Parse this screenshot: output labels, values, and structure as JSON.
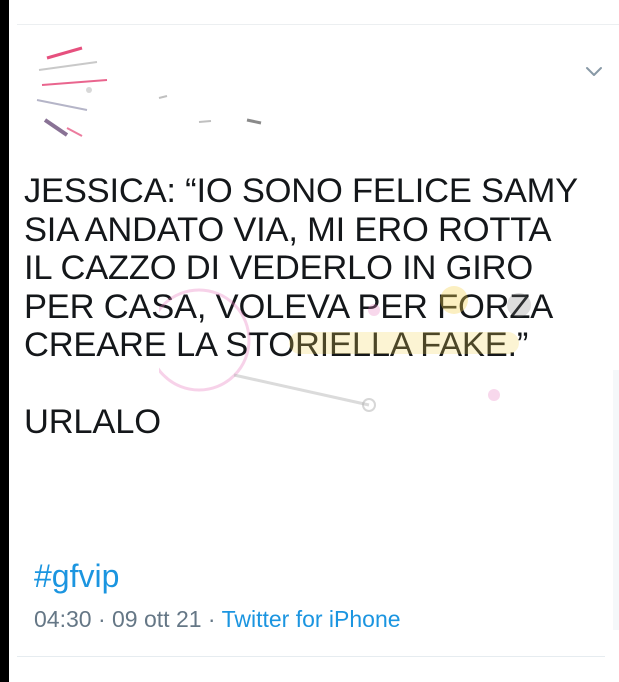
{
  "tweet": {
    "text_lines": [
      "JESSICA: “IO SONO FELICE SAMY",
      "SIA ANDATO VIA, MI ERO ROTTA",
      "IL CAZZO DI VEDERLO IN GIRO",
      "PER CASA, VOLEVA PER FORZA",
      "CREARE LA STORIELLA FAKE.”"
    ],
    "closing_line": "URLALO",
    "hashtag": "#gfvip",
    "time": "04:30",
    "separator": " · ",
    "date": "09 ott 21",
    "source": "Twitter for iPhone"
  },
  "icons": {
    "menu": "chevron-down-icon",
    "avatar": "redacted-avatar"
  },
  "colors": {
    "text": "#14171a",
    "link": "#1b95e0",
    "meta": "#657786",
    "watermark": "#e87fc0"
  }
}
